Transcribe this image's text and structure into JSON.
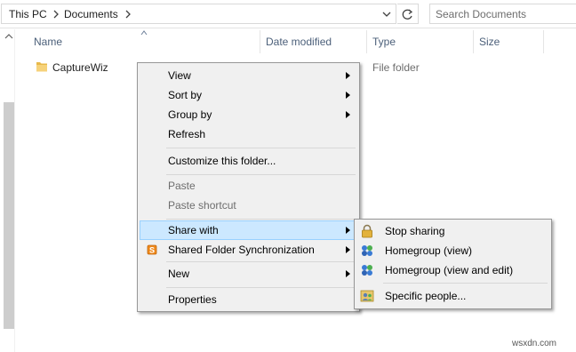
{
  "address_bar": {
    "breadcrumbs": [
      "This PC",
      "Documents"
    ],
    "search_placeholder": "Search Documents"
  },
  "columns": {
    "name": "Name",
    "date_modified": "Date modified",
    "type": "Type",
    "size": "Size"
  },
  "files": [
    {
      "name": "CaptureWiz",
      "type": "File folder",
      "icon": "folder-icon"
    }
  ],
  "context_menu": {
    "items": [
      {
        "label": "View",
        "submenu": true
      },
      {
        "label": "Sort by",
        "submenu": true
      },
      {
        "label": "Group by",
        "submenu": true
      },
      {
        "label": "Refresh",
        "submenu": false
      },
      {
        "label": "Customize this folder...",
        "submenu": false
      },
      {
        "label": "Paste",
        "submenu": false,
        "disabled": true
      },
      {
        "label": "Paste shortcut",
        "submenu": false,
        "disabled": true
      },
      {
        "label": "Share with",
        "submenu": true,
        "highlighted": true
      },
      {
        "label": "Shared Folder Synchronization",
        "submenu": true,
        "icon": "sync-icon"
      },
      {
        "label": "New",
        "submenu": true
      },
      {
        "label": "Properties",
        "submenu": false
      }
    ]
  },
  "share_submenu": {
    "items": [
      {
        "label": "Stop sharing",
        "icon": "lock-icon"
      },
      {
        "label": "Homegroup (view)",
        "icon": "homegroup-icon"
      },
      {
        "label": "Homegroup (view and edit)",
        "icon": "homegroup-icon"
      },
      {
        "label": "Specific people...",
        "icon": "people-icon"
      }
    ]
  },
  "watermark": "wsxdn.com",
  "colors": {
    "highlight_bg": "#cce8ff",
    "highlight_border": "#99d1ff",
    "menu_bg": "#f0f0f0",
    "column_text": "#4c607a",
    "folder_yellow": "#e8b94a"
  }
}
